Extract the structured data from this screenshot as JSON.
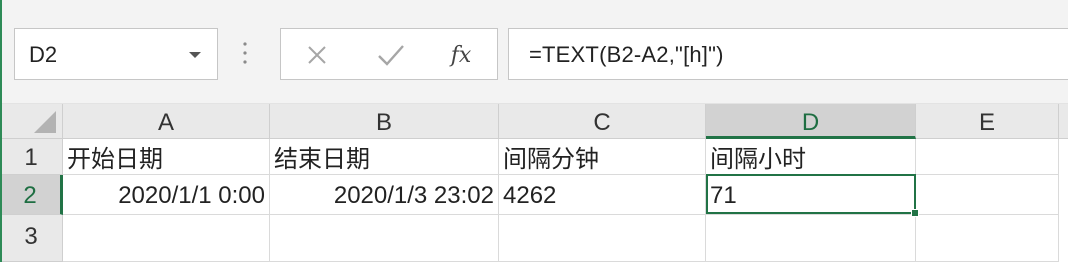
{
  "name_box": {
    "value": "D2"
  },
  "formula_bar": {
    "cancel_icon": "close-icon",
    "enter_icon": "check-icon",
    "fx_label": "fx",
    "formula": "=TEXT(B2-A2,\"[h]\")"
  },
  "columns": [
    "A",
    "B",
    "C",
    "D",
    "E"
  ],
  "rows": [
    "1",
    "2",
    "3"
  ],
  "cells": {
    "A1": "开始日期",
    "B1": "结束日期",
    "C1": "间隔分钟",
    "D1": "间隔小时",
    "A2": "2020/1/1 0:00",
    "B2": "2020/1/3 23:02",
    "C2": "4262",
    "D2": "71"
  },
  "selected_cell": "D2",
  "colors": {
    "accent": "#217346",
    "header_bg": "#e9e9e9",
    "toolbar_bg": "#f3f3f3"
  }
}
